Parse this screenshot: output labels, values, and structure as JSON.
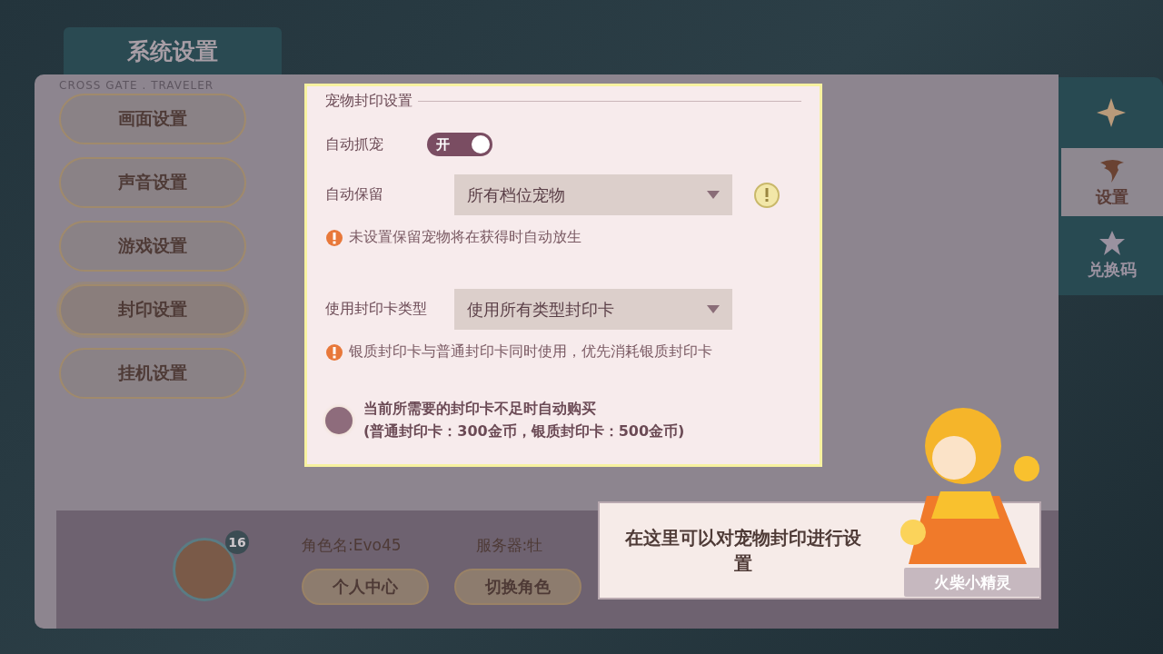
{
  "header": {
    "title": "系统设置",
    "subtitle": "CROSS GATE . TRAVELER"
  },
  "menu": [
    {
      "label": "画面设置",
      "selected": false
    },
    {
      "label": "声音设置",
      "selected": false
    },
    {
      "label": "游戏设置",
      "selected": false
    },
    {
      "label": "封印设置",
      "selected": true
    },
    {
      "label": "挂机设置",
      "selected": false
    }
  ],
  "section": {
    "title": "宠物封印设置",
    "rows": [
      {
        "kind": "toggle",
        "label": "自动抓宠",
        "on": true,
        "toggle_text": "开"
      },
      {
        "kind": "dropdown",
        "label": "自动保留",
        "value": "所有档位宠物",
        "info": true,
        "note": "未设置保留宠物将在获得时自动放生"
      },
      {
        "kind": "dropdown",
        "label": "使用封印卡类型",
        "value": "使用所有类型封印卡",
        "info": false,
        "note": "银质封印卡与普通封印卡同时使用，优先消耗银质封印卡"
      },
      {
        "kind": "checkbox",
        "checked": false,
        "lines": [
          "当前所需要的封印卡不足时自动购买",
          "(普通封印卡：300金币，银质封印卡：500金币)"
        ]
      }
    ]
  },
  "side_tabs": [
    {
      "label": "设置",
      "selected": true
    },
    {
      "label": "兑换码",
      "selected": false
    }
  ],
  "profile": {
    "level": "16",
    "name": "角色名:Evo45",
    "server": "服务器:牡",
    "buttons": [
      "个人中心",
      "切换角色"
    ]
  },
  "tip": {
    "text": "在这里可以对宠物封印进行设置",
    "speaker": "火柴小精灵"
  }
}
